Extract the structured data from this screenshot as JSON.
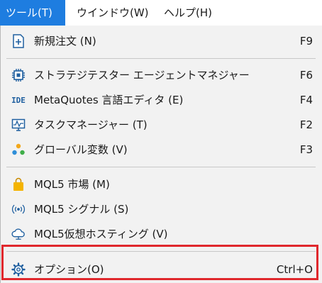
{
  "menubar": {
    "tools": "ツール(T)",
    "window": "ウインドウ(W)",
    "help": "ヘルプ(H)"
  },
  "menu": {
    "items": [
      {
        "label": "新規注文 (N)",
        "shortcut": "F9",
        "icon": "new-order-icon"
      },
      {
        "label": "ストラテジテスター エージェントマネジャー",
        "shortcut": "F6",
        "icon": "chip-icon"
      },
      {
        "label": "MetaQuotes 言語エディタ (E)",
        "shortcut": "F4",
        "icon": "ide-icon",
        "icon_text": "IDE"
      },
      {
        "label": "タスクマネージャー (T)",
        "shortcut": "F2",
        "icon": "monitor-icon"
      },
      {
        "label": "グローバル変数 (V)",
        "shortcut": "F3",
        "icon": "dots-icon"
      },
      {
        "label": "MQL5 市場 (M)",
        "shortcut": "",
        "icon": "shopping-bag-icon"
      },
      {
        "label": "MQL5 シグナル (S)",
        "shortcut": "",
        "icon": "signal-icon"
      },
      {
        "label": "MQL5仮想ホスティング (V)",
        "shortcut": "",
        "icon": "cloud-icon"
      },
      {
        "label": "オプション(O)",
        "shortcut": "Ctrl+O",
        "icon": "gear-icon"
      }
    ]
  },
  "colors": {
    "active_menu": "#1e7de0",
    "highlight_border": "#e0282d",
    "menu_bg": "#f2f2f2"
  }
}
